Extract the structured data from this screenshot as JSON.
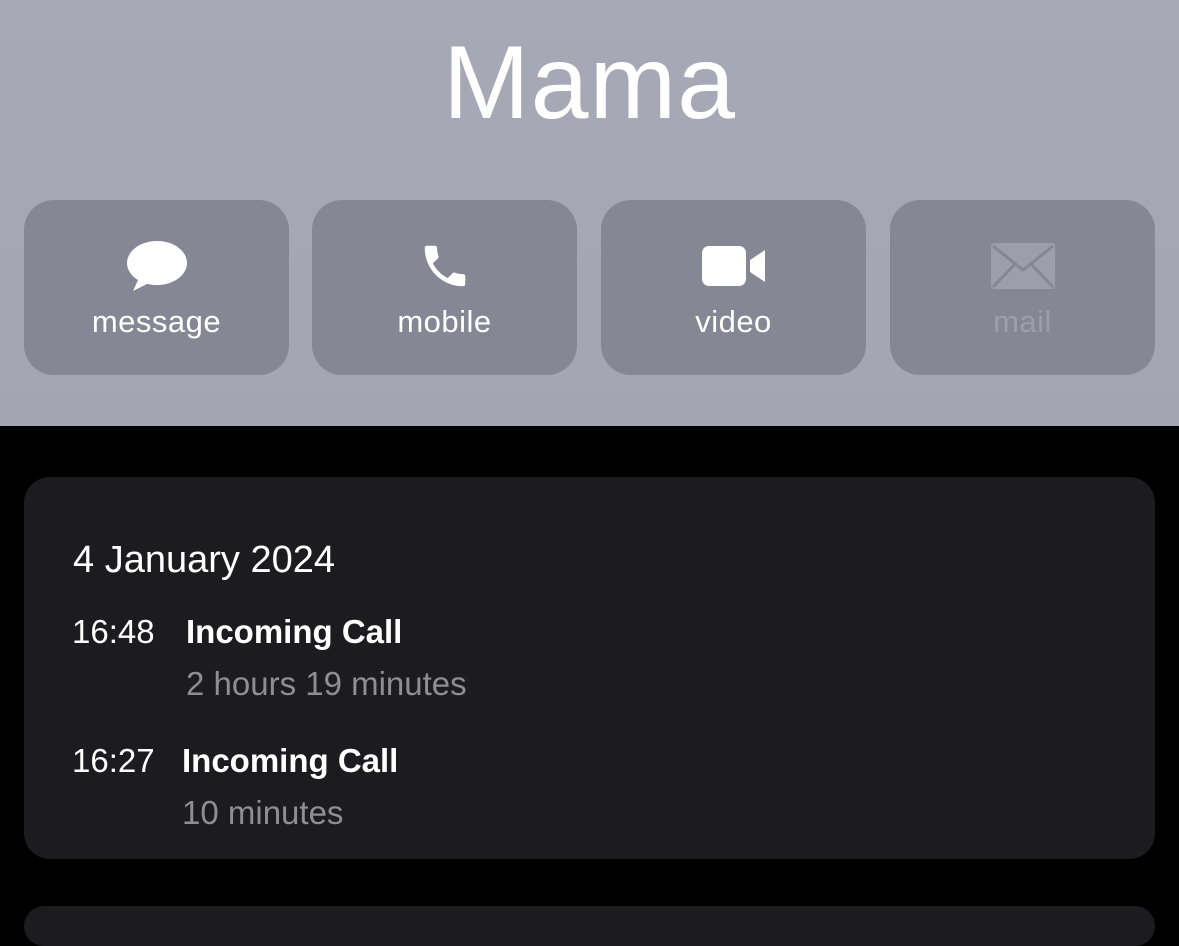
{
  "contact": {
    "name": "Mama"
  },
  "actions": [
    {
      "label": "message",
      "icon": "message-bubble-icon",
      "enabled": true
    },
    {
      "label": "mobile",
      "icon": "phone-icon",
      "enabled": true
    },
    {
      "label": "video",
      "icon": "video-camera-icon",
      "enabled": true
    },
    {
      "label": "mail",
      "icon": "envelope-icon",
      "enabled": false
    }
  ],
  "history": {
    "date": "4 January 2024",
    "calls": [
      {
        "time": "16:48",
        "type": "Incoming Call",
        "duration": "2 hours 19 minutes"
      },
      {
        "time": "16:27",
        "type": "Incoming Call",
        "duration": "10 minutes"
      }
    ]
  },
  "colors": {
    "header_bg": "#a5a7b4",
    "button_bg": "#858795",
    "card_bg": "#1c1c1e",
    "secondary_text": "#8e8e93"
  }
}
